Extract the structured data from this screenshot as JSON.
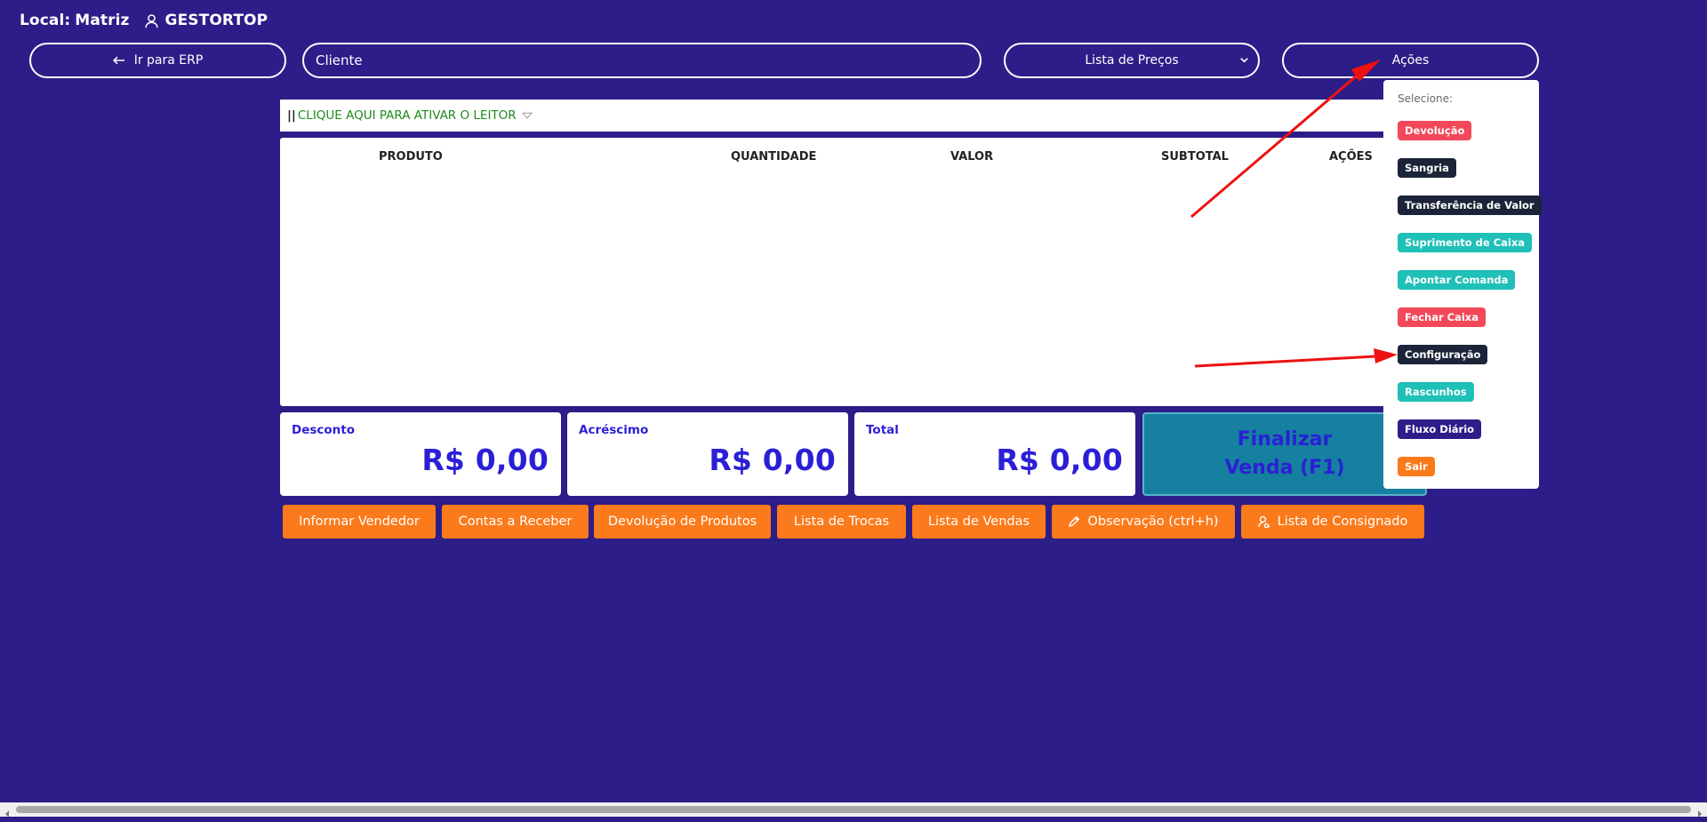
{
  "header": {
    "local_label": "Local:",
    "local_value": "Matriz",
    "user_name": "GESTORTOP",
    "user_icon": "user-icon"
  },
  "toolbar": {
    "erp_button": "Ir para ERP",
    "client_placeholder": "Cliente",
    "price_list_selected": "Lista de Preços",
    "actions_button": "Ações"
  },
  "reader": {
    "barcode_glyph": "||",
    "text": "CLIQUE AQUI PARA ATIVAR O LEITOR"
  },
  "table": {
    "columns": [
      "PRODUTO",
      "QUANTIDADE",
      "VALOR",
      "SUBTOTAL",
      "AÇÕES"
    ],
    "rows": []
  },
  "totals": {
    "discount_label": "Desconto",
    "discount_value": "R$ 0,00",
    "surcharge_label": "Acréscimo",
    "surcharge_value": "R$ 0,00",
    "total_label": "Total",
    "total_value": "R$ 0,00"
  },
  "finalize": {
    "line1": "Finalizar",
    "line2": "Venda (F1)"
  },
  "bottom_buttons": [
    "Informar Vendedor",
    "Contas a Receber",
    "Devolução de Produtos",
    "Lista de Trocas",
    "Lista de Vendas",
    "Observação (ctrl+h)",
    "Lista de Consignado"
  ],
  "actions_menu": {
    "header": "Selecione:",
    "items": [
      {
        "label": "Devolução",
        "color": "#f2485a"
      },
      {
        "label": "Sangria",
        "color": "#1b2438"
      },
      {
        "label": "Transferência de Valor",
        "color": "#1b2438"
      },
      {
        "label": "Suprimento de Caixa",
        "color": "#1fc0b8"
      },
      {
        "label": "Apontar Comanda",
        "color": "#1fc0b8"
      },
      {
        "label": "Fechar Caixa",
        "color": "#f2485a"
      },
      {
        "label": "Configuração",
        "color": "#1b2438"
      },
      {
        "label": "Rascunhos",
        "color": "#1fc0b8"
      },
      {
        "label": "Fluxo Diário",
        "color": "#2d1d88"
      },
      {
        "label": "Sair",
        "color": "#fb7a1b"
      }
    ]
  },
  "colors": {
    "background": "#2d1d88",
    "accent_orange": "#fb7a1b",
    "value_blue": "#2b1fd6",
    "finalize_teal": "#15809f",
    "annotation_red": "#ee1111"
  }
}
